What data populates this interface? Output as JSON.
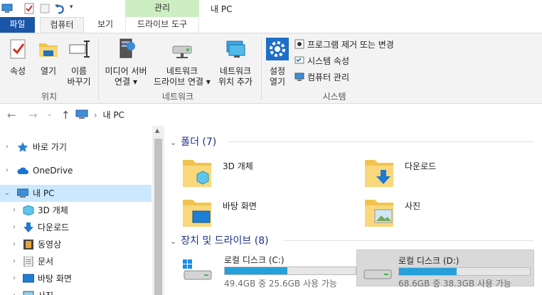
{
  "window": {
    "title": "내 PC",
    "context_tab": "관리"
  },
  "tabs": {
    "file": "파일",
    "computer": "컴퓨터",
    "view": "보기",
    "drive_tools": "드라이브 도구"
  },
  "ribbon": {
    "properties": "속성",
    "open": "열기",
    "rename_line1": "이름",
    "rename_line2": "바꾸기",
    "group_location": "위치",
    "media_line1": "미디어 서버",
    "media_line2": "연결",
    "map_drive_line1": "네트워크",
    "map_drive_line2": "드라이브 연결",
    "add_location_line1": "네트워크",
    "add_location_line2": "위치 추가",
    "group_network": "네트워크",
    "settings_line1": "설정",
    "settings_line2": "열기",
    "uninstall": "프로그램 제거 또는 변경",
    "system_properties": "시스템 속성",
    "computer_management": "컴퓨터 관리",
    "group_system": "시스템"
  },
  "address": {
    "path": "내 PC"
  },
  "nav": {
    "items": [
      {
        "label": "바로 가기"
      },
      {
        "label": "OneDrive"
      },
      {
        "label": "내 PC"
      },
      {
        "label": "3D 개체"
      },
      {
        "label": "다운로드"
      },
      {
        "label": "동영상"
      },
      {
        "label": "문서"
      },
      {
        "label": "바탕 화면"
      },
      {
        "label": "사진"
      }
    ]
  },
  "content": {
    "folders_header": "폴더 (7)",
    "folders": [
      {
        "name": "3D 개체"
      },
      {
        "name": "다운로드"
      },
      {
        "name": "바탕 화면"
      },
      {
        "name": "사진"
      }
    ],
    "drives_header": "장치 및 드라이브 (8)",
    "drives": [
      {
        "name": "로컬 디스크 (C:)",
        "free_text": "49.4GB 중 25.6GB 사용 가능",
        "used_fraction": 0.48
      },
      {
        "name": "로컬 디스크 (D:)",
        "free_text": "68.6GB 중 38.3GB 사용 가능",
        "used_fraction": 0.44
      }
    ]
  },
  "colors": {
    "accent": "#1a56a8",
    "manage_tab": "#cdeec3",
    "selection": "#cce8ff",
    "header_text": "#1e3287",
    "drive_bar": "#26a0da"
  }
}
